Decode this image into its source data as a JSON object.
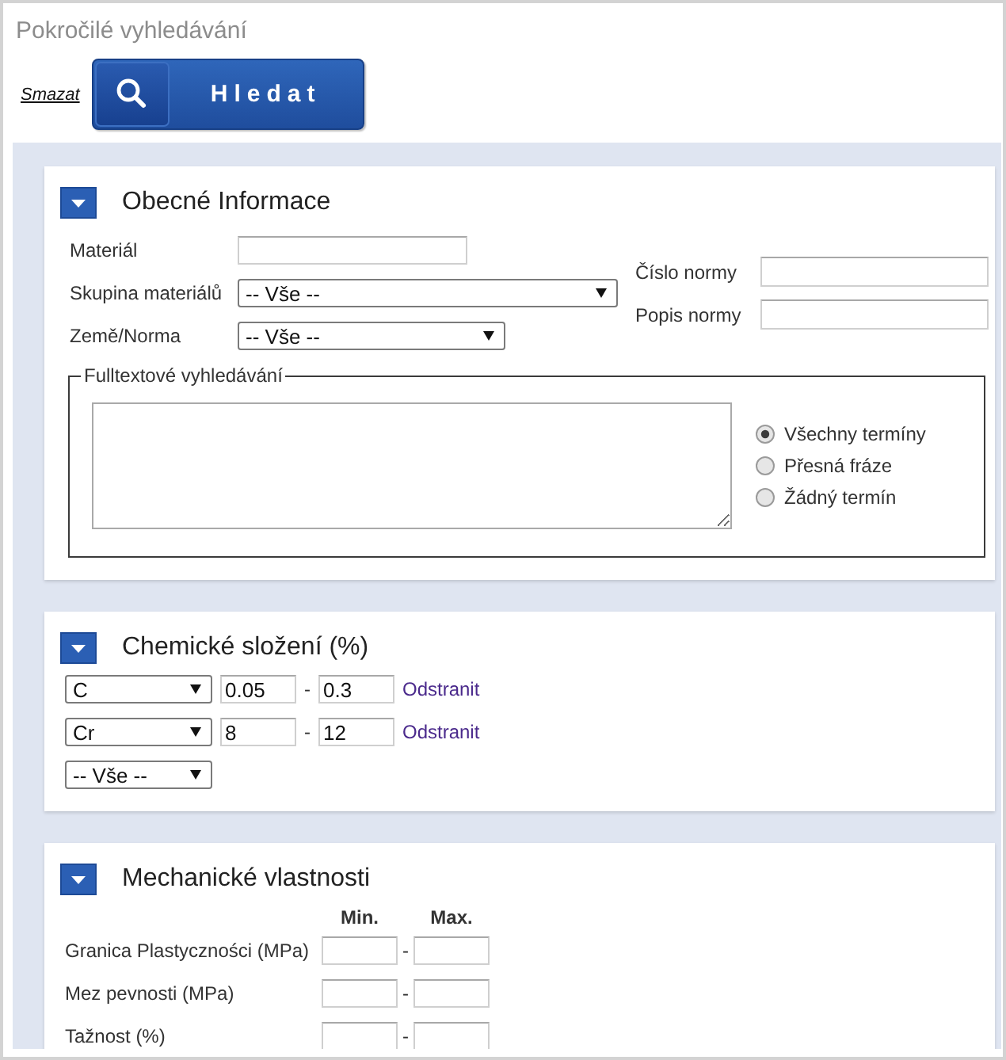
{
  "page": {
    "title": "Pokročilé vyhledávání"
  },
  "toolbar": {
    "clear_link": "Smazat",
    "search_button": "Hledat"
  },
  "sections": [
    {
      "kind": "general",
      "title": "Obecné Informace",
      "expanded": true,
      "fields": [
        {
          "kind": "text",
          "label": "Materiál"
        },
        {
          "kind": "select",
          "label": "Skupina materiálů",
          "value": "-- Vše --"
        },
        {
          "kind": "select",
          "label": "Země/Norma",
          "value": "-- Vše --"
        }
      ],
      "side_fields": [
        {
          "kind": "text",
          "label": "Číslo normy"
        },
        {
          "kind": "text",
          "label": "Popis normy"
        }
      ],
      "fulltext": {
        "legend": "Fulltextové vyhledávání",
        "options": [
          {
            "label": "Všechny termíny",
            "selected": true
          },
          {
            "label": "Přesná fráze",
            "selected": false
          },
          {
            "label": "Žádný termín",
            "selected": false
          }
        ]
      }
    },
    {
      "kind": "chemistry",
      "title": "Chemické složení (%)",
      "expanded": true,
      "rows": [
        {
          "element": "C",
          "min": "0.05",
          "separator": "-",
          "max": "0.3",
          "remove_link": "Odstranit"
        },
        {
          "element": "Cr",
          "min": "8",
          "separator": "-",
          "max": "12",
          "remove_link": "Odstranit"
        }
      ],
      "add_select": "-- Vše --"
    },
    {
      "kind": "mechanical",
      "title": "Mechanické vlastnosti",
      "expanded": true,
      "columns": [
        "Min.",
        "Max."
      ],
      "rows": [
        {
          "label": "Granica Plastyczności (MPa)",
          "separator": "-"
        },
        {
          "label": "Mez pevnosti (MPa)",
          "separator": "-"
        },
        {
          "label": "Tažnost (%)",
          "separator": "-"
        }
      ]
    }
  ]
}
